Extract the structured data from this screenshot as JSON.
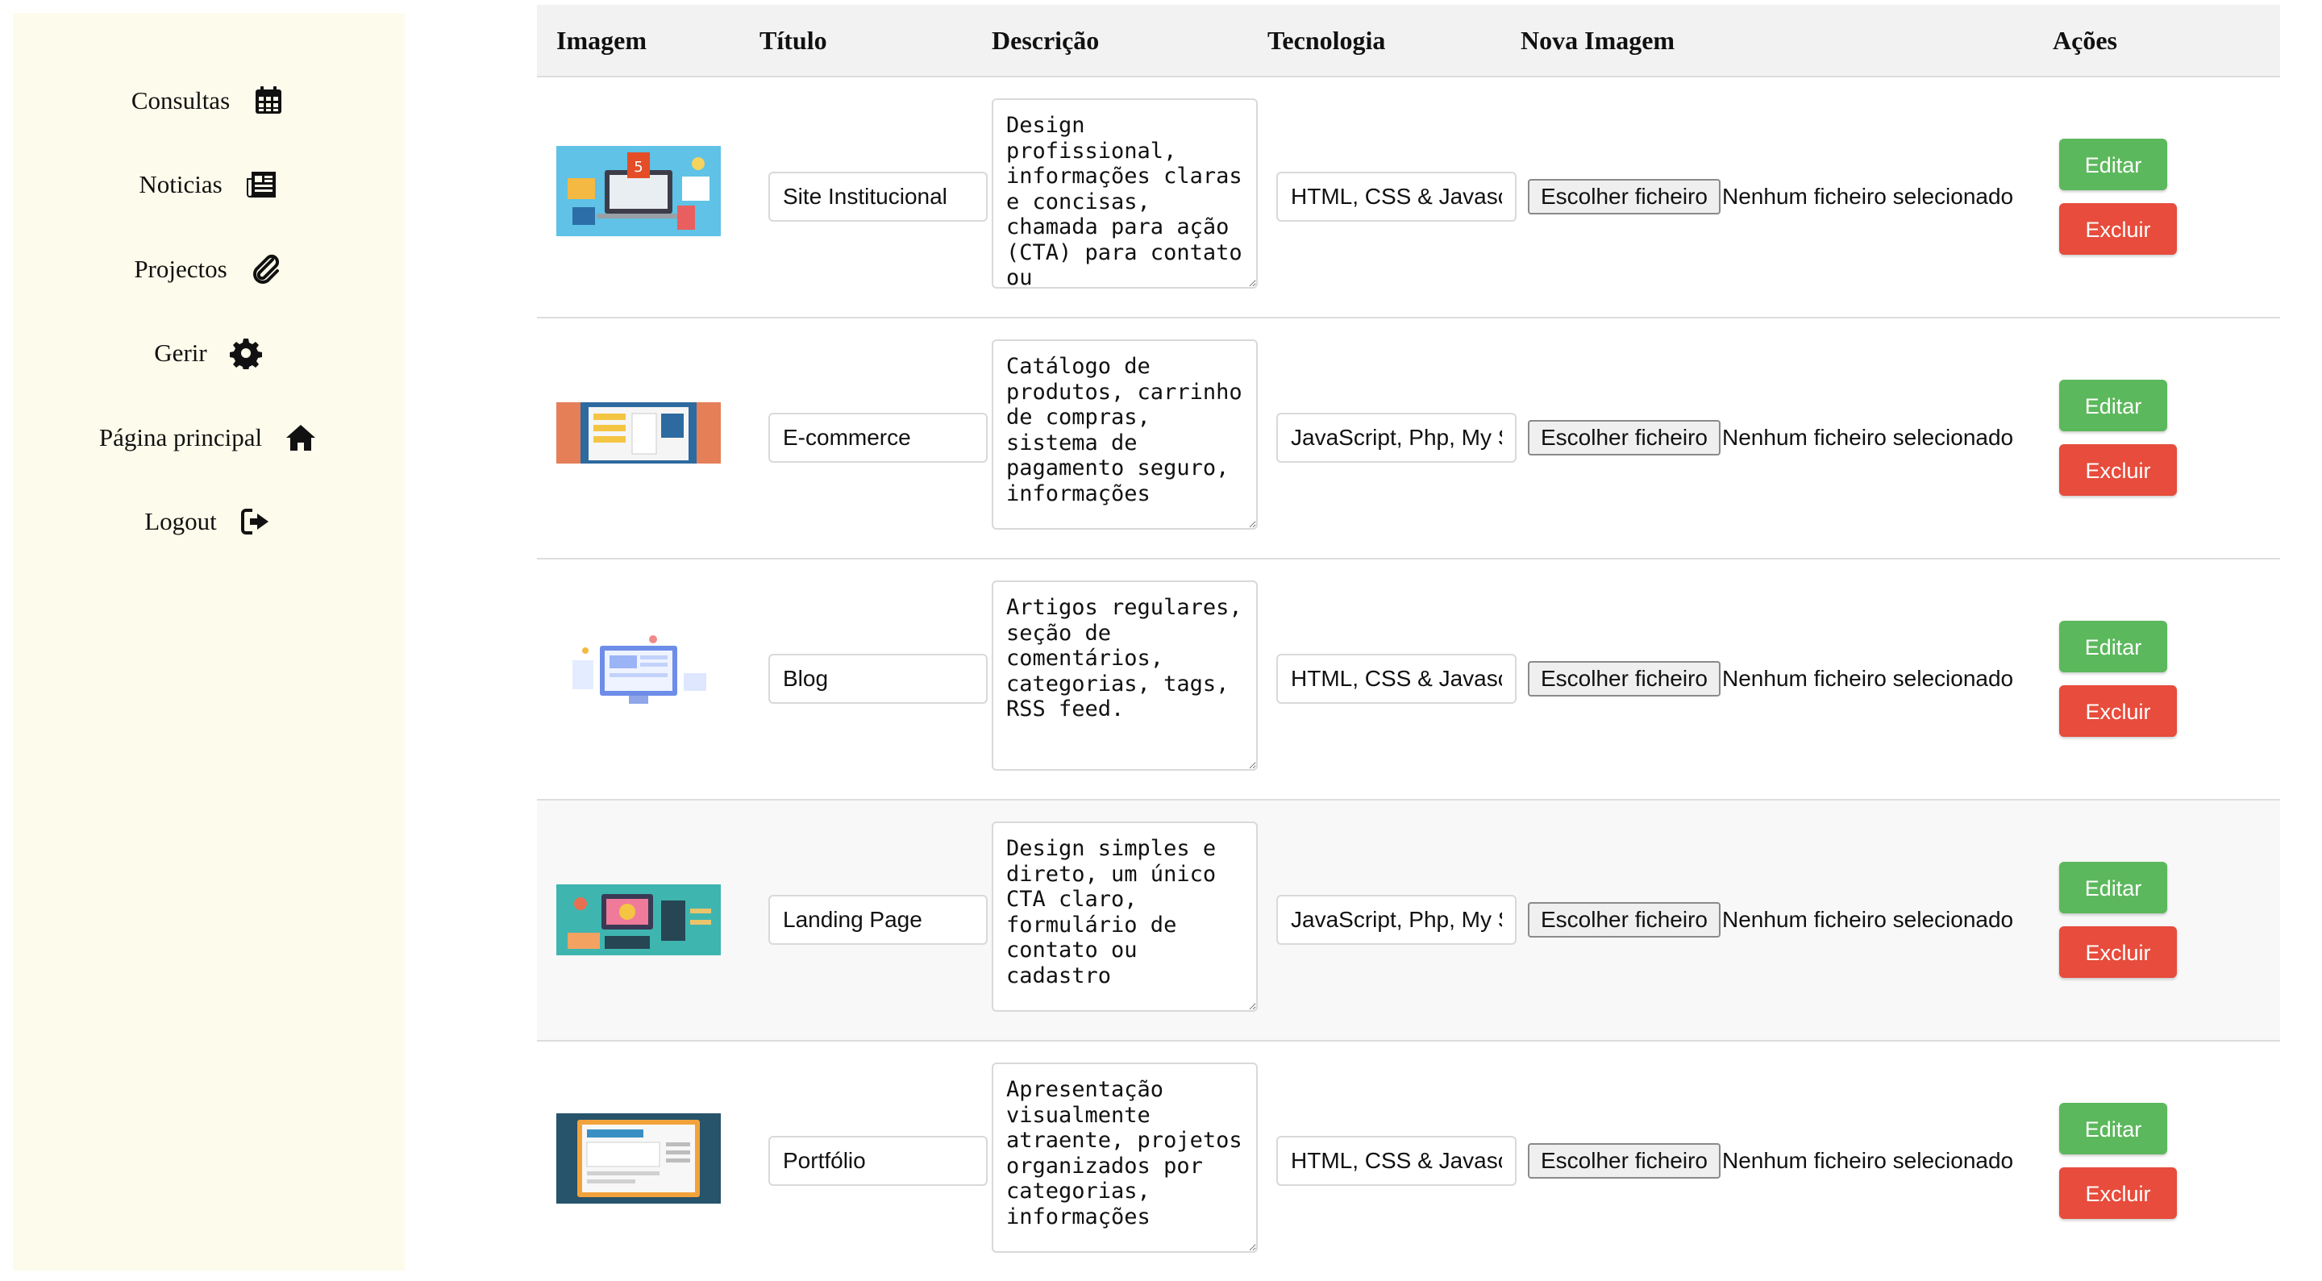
{
  "sidebar": {
    "items": [
      {
        "label": "Consultas",
        "icon": "calendar-icon"
      },
      {
        "label": "Noticias",
        "icon": "newspaper-icon"
      },
      {
        "label": "Projectos",
        "icon": "paperclip-icon"
      },
      {
        "label": "Gerir",
        "icon": "gear-icon"
      },
      {
        "label": "Página principal",
        "icon": "home-icon"
      },
      {
        "label": "Logout",
        "icon": "logout-icon"
      }
    ]
  },
  "table": {
    "headers": [
      "Imagem",
      "Título",
      "Descrição",
      "Tecnologia",
      "Nova Imagem",
      "Ações"
    ],
    "file_button_label": "Escolher ficheiro",
    "file_status": "Nenhum ficheiro selecionado",
    "edit_label": "Editar",
    "delete_label": "Excluir",
    "rows": [
      {
        "image": "website-design-illustration",
        "title": "Site Institucional",
        "description": "Design profissional, informações claras e concisas, chamada para ação (CTA) para contato ou",
        "technology": "HTML, CSS & Javascript"
      },
      {
        "image": "ecommerce-illustration",
        "title": "E-commerce",
        "description": "Catálogo de produtos, carrinho de compras, sistema de pagamento seguro, informações",
        "technology": "JavaScript, Php, My SQL"
      },
      {
        "image": "blog-illustration",
        "title": "Blog",
        "description": "Artigos regulares, seção de comentários, categorias, tags, RSS feed.",
        "technology": "HTML, CSS & Javascript"
      },
      {
        "image": "landing-page-illustration",
        "title": "Landing Page",
        "description": "Design simples e direto, um único CTA claro, formulário de contato ou cadastro",
        "technology": "JavaScript, Php, My SQL"
      },
      {
        "image": "portfolio-illustration",
        "title": "Portfólio",
        "description": "Apresentação visualmente atraente, projetos organizados por categorias, informações",
        "technology": "HTML, CSS & Javascript"
      }
    ]
  },
  "colors": {
    "sidebar_bg": "#fdfbeb",
    "edit": "#5cb85c",
    "delete": "#e74c3c",
    "header_bg": "#f2f2f2"
  }
}
